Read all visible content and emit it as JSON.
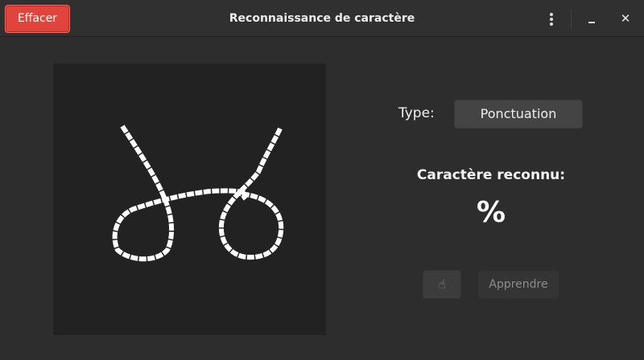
{
  "titlebar": {
    "clear_label": "Effacer",
    "title": "Reconnaissance de caractère",
    "menu_icon": "vertical-dots-icon",
    "minimize_icon": "minimize-icon",
    "close_icon": "close-icon",
    "close_glyph": "✕"
  },
  "form": {
    "type_label": "Type:",
    "type_value": "Ponctuation"
  },
  "result": {
    "title": "Caractère reconnu:",
    "character": "%"
  },
  "actions": {
    "hand_icon": "hand-pointer-icon",
    "hand_glyph": "☝",
    "learn_label": "Apprendre"
  },
  "colors": {
    "accent": "#e0443b",
    "canvas_bg": "#222222",
    "window_bg": "#2d2d2d",
    "stroke": "#ffffff"
  }
}
